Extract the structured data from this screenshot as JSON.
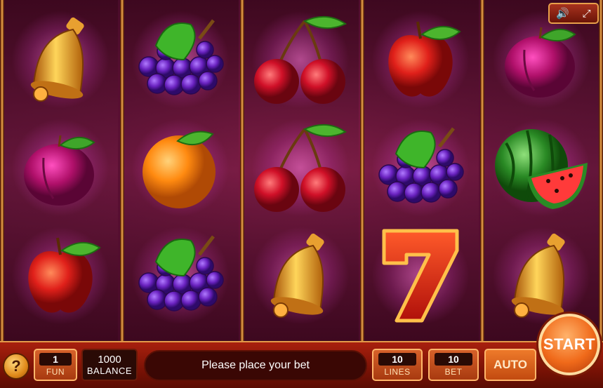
{
  "game": {
    "reels": [
      [
        "bell",
        "plum",
        "apple"
      ],
      [
        "grapes",
        "orange",
        "grapes"
      ],
      [
        "cherry",
        "cherry",
        "bell"
      ],
      [
        "apple",
        "grapes",
        "seven"
      ],
      [
        "plum",
        "watermelon",
        "bell"
      ]
    ]
  },
  "topControls": {
    "sound_icon": "speaker-icon",
    "fullscreen_icon": "fullscreen-icon"
  },
  "bottomBar": {
    "help_label": "?",
    "fun": {
      "value": "1",
      "label": "FUN"
    },
    "balance": {
      "value": "1000",
      "label": "BALANCE"
    },
    "message": "Please place your bet",
    "lines": {
      "value": "10",
      "label": "LINES"
    },
    "bet": {
      "value": "10",
      "label": "BET"
    },
    "auto_label": "AUTO",
    "start_label": "START"
  },
  "colors": {
    "accent": "#f06a1a",
    "frame": "#e39a4a",
    "background": "#5a0f33"
  }
}
